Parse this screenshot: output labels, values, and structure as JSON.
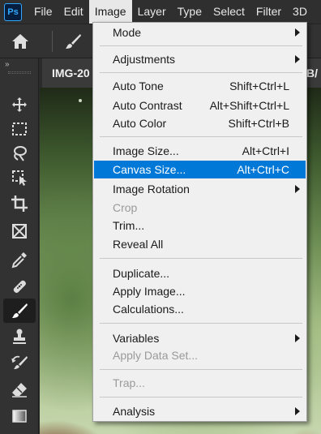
{
  "app": {
    "logo_text": "Ps"
  },
  "menubar": {
    "items": [
      {
        "label": "File",
        "active": false
      },
      {
        "label": "Edit",
        "active": false
      },
      {
        "label": "Image",
        "active": true
      },
      {
        "label": "Layer",
        "active": false
      },
      {
        "label": "Type",
        "active": false
      },
      {
        "label": "Select",
        "active": false
      },
      {
        "label": "Filter",
        "active": false
      },
      {
        "label": "3D",
        "active": false
      }
    ]
  },
  "options_bar": {
    "home_icon": "home-icon",
    "tool_icon": "brush-icon"
  },
  "document_tab": {
    "title": "IMG-20",
    "title_suffix": "GB/"
  },
  "toolbar": {
    "collapse_glyph": "»",
    "tools": [
      {
        "name": "move-tool",
        "icon": "move-icon",
        "selected": false
      },
      {
        "name": "marquee-tool",
        "icon": "marquee-icon",
        "selected": false
      },
      {
        "name": "lasso-tool",
        "icon": "lasso-icon",
        "selected": false
      },
      {
        "name": "object-selection-tool",
        "icon": "object-selection-icon",
        "selected": false
      },
      {
        "name": "crop-tool",
        "icon": "crop-icon",
        "selected": false
      },
      {
        "name": "frame-tool",
        "icon": "frame-icon",
        "selected": false
      },
      {
        "name": "eyedropper-tool",
        "icon": "eyedropper-icon",
        "selected": false
      },
      {
        "name": "healing-brush-tool",
        "icon": "bandage-icon",
        "selected": false
      },
      {
        "name": "brush-tool",
        "icon": "brush-icon",
        "selected": true
      },
      {
        "name": "clone-stamp-tool",
        "icon": "stamp-icon",
        "selected": false
      },
      {
        "name": "history-brush-tool",
        "icon": "history-brush-icon",
        "selected": false
      },
      {
        "name": "eraser-tool",
        "icon": "eraser-icon",
        "selected": false
      },
      {
        "name": "gradient-tool",
        "icon": "gradient-icon",
        "selected": false
      }
    ]
  },
  "image_menu": {
    "items": [
      {
        "label": "Mode",
        "shortcut": "",
        "submenu": true,
        "disabled": false
      },
      {
        "label": "Adjustments",
        "shortcut": "",
        "submenu": true,
        "disabled": false
      },
      {
        "label": "Auto Tone",
        "shortcut": "Shift+Ctrl+L",
        "submenu": false,
        "disabled": false
      },
      {
        "label": "Auto Contrast",
        "shortcut": "Alt+Shift+Ctrl+L",
        "submenu": false,
        "disabled": false
      },
      {
        "label": "Auto Color",
        "shortcut": "Shift+Ctrl+B",
        "submenu": false,
        "disabled": false
      },
      {
        "label": "Image Size...",
        "shortcut": "Alt+Ctrl+I",
        "submenu": false,
        "disabled": false
      },
      {
        "label": "Canvas Size...",
        "shortcut": "Alt+Ctrl+C",
        "submenu": false,
        "disabled": false,
        "highlighted": true
      },
      {
        "label": "Image Rotation",
        "shortcut": "",
        "submenu": true,
        "disabled": false
      },
      {
        "label": "Crop",
        "shortcut": "",
        "submenu": false,
        "disabled": true
      },
      {
        "label": "Trim...",
        "shortcut": "",
        "submenu": false,
        "disabled": false
      },
      {
        "label": "Reveal All",
        "shortcut": "",
        "submenu": false,
        "disabled": false
      },
      {
        "label": "Duplicate...",
        "shortcut": "",
        "submenu": false,
        "disabled": false
      },
      {
        "label": "Apply Image...",
        "shortcut": "",
        "submenu": false,
        "disabled": false
      },
      {
        "label": "Calculations...",
        "shortcut": "",
        "submenu": false,
        "disabled": false
      },
      {
        "label": "Variables",
        "shortcut": "",
        "submenu": true,
        "disabled": false
      },
      {
        "label": "Apply Data Set...",
        "shortcut": "",
        "submenu": false,
        "disabled": true
      },
      {
        "label": "Trap...",
        "shortcut": "",
        "submenu": false,
        "disabled": true
      },
      {
        "label": "Analysis",
        "shortcut": "",
        "submenu": true,
        "disabled": false
      }
    ]
  },
  "colors": {
    "highlight": "#0078d7",
    "menu_bg": "#f0f0f0",
    "chrome_bg": "#323232",
    "disabled_text": "#9a9a9a"
  }
}
